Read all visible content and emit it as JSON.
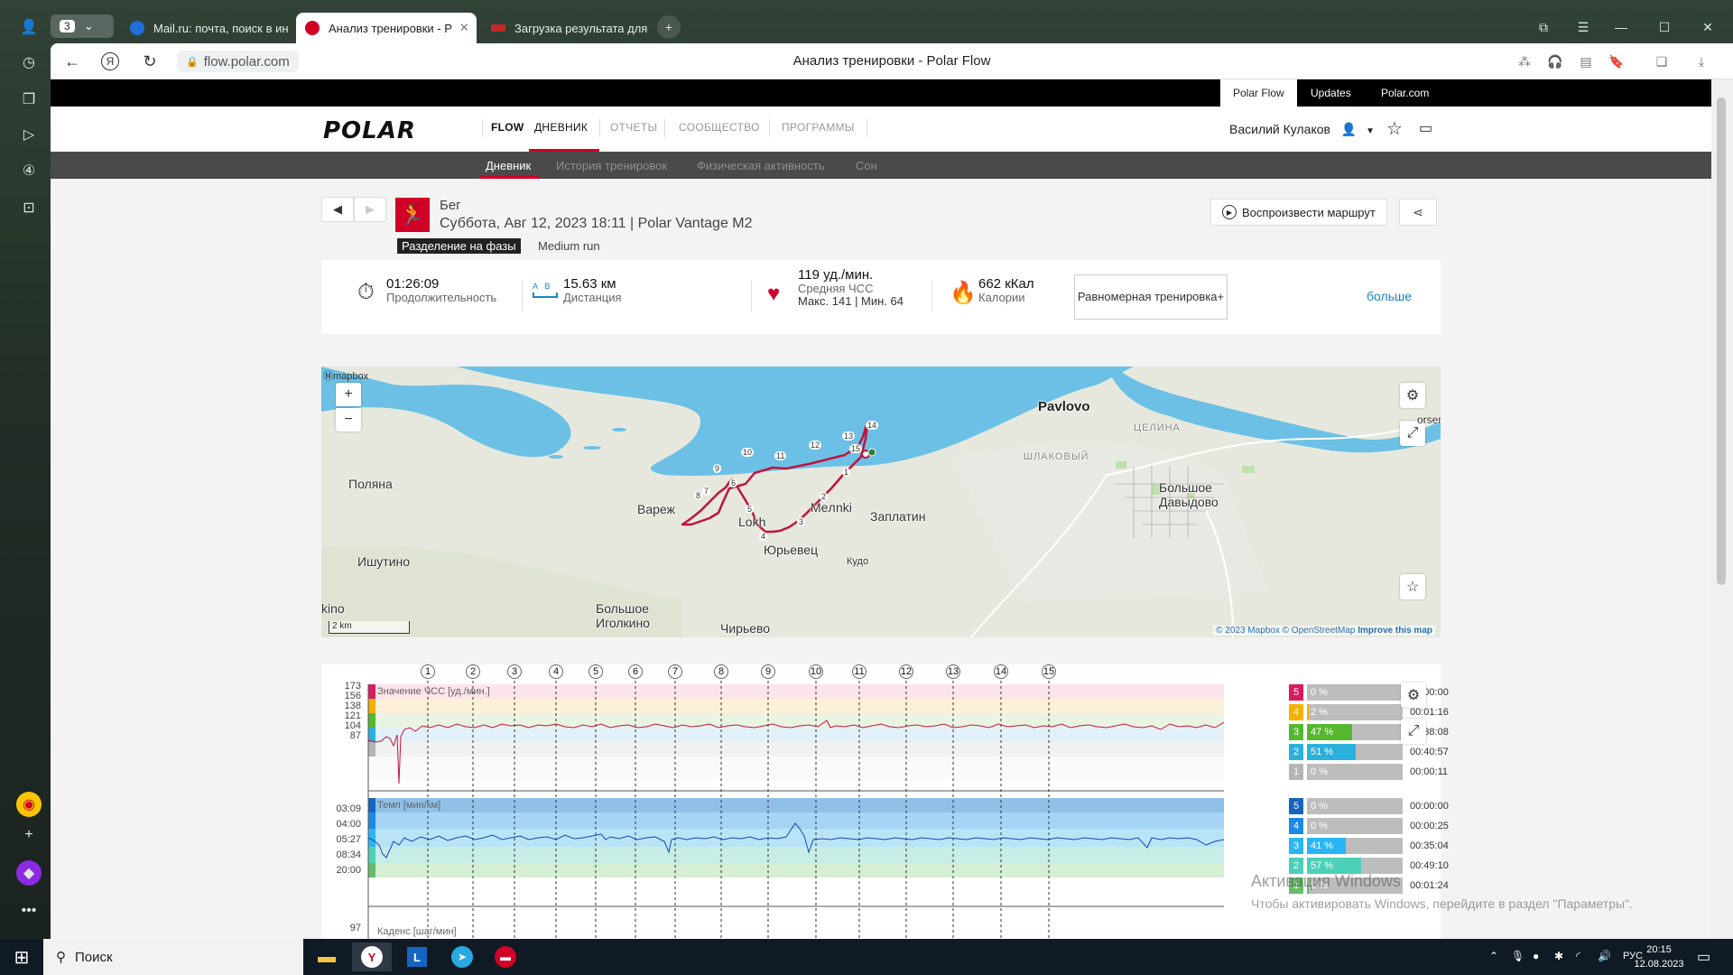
{
  "browser": {
    "tab_count": "3",
    "tabs": [
      {
        "title": "Mail.ru: почта, поиск в ин"
      },
      {
        "title": "Анализ тренировки - P"
      },
      {
        "title": "Загрузка результата для"
      }
    ],
    "url": "flow.polar.com",
    "page_title": "Анализ тренировки - Polar Flow"
  },
  "top_links": [
    "Polar Flow",
    "Updates",
    "Polar.com"
  ],
  "main_nav": {
    "logo": "POLAR",
    "flow": "FLOW",
    "items": [
      "ДНЕВНИК",
      "ОТЧЕТЫ",
      "СООБЩЕСТВО",
      "ПРОГРАММЫ"
    ],
    "user": "Василий Кулаков"
  },
  "sub_nav": [
    "Дневник",
    "История тренировок",
    "Физическая активность",
    "Сон"
  ],
  "training": {
    "sport": "Бег",
    "subtitle": "Суббота, Авг 12, 2023 18:11 | Polar Vantage M2",
    "phase_badge": "Разделение на фазы",
    "phase_name": "Medium run",
    "replay_label": "Воспроизвести маршрут"
  },
  "summary": {
    "duration_value": "01:26:09",
    "duration_label": "Продолжительность",
    "distance_a": "A",
    "distance_b": "B",
    "distance_value": "15.63 км",
    "distance_label": "Дистанция",
    "hr_value": "119 уд./мин.",
    "hr_label": "Средняя ЧСС",
    "hr_extra": "Макс. 141  |  Мин. 64",
    "cal_value": "662 кКал",
    "cal_label": "Калории",
    "phase_btn": "Равномерная тренировка+",
    "more": "больше"
  },
  "map": {
    "logo": "mapbox",
    "zoom_in": "+",
    "zoom_out": "−",
    "labels": [
      "Pavlovo",
      "Поляна",
      "Вареж",
      "Lokh",
      "Meл",
      "nki",
      "Заплатин",
      "Юрьевец",
      "Ишутино",
      "Большое Давыдово",
      "kino",
      "Большое Иголкино",
      "Чирьево",
      "Кудо",
      "ЦЕЛИНА",
      "ШЛАКОВЫЙ",
      "orser"
    ],
    "route_marks": [
      "1",
      "2",
      "3",
      "4",
      "5",
      "6",
      "7",
      "8",
      "9",
      "10",
      "11",
      "12",
      "13",
      "14",
      "15"
    ],
    "scale": "2 km",
    "attribution_1": "© 2023 Mapbox",
    "attribution_2": "© OpenStreetMap",
    "attribution_3": "Improve this map"
  },
  "charts": {
    "laps": [
      "1",
      "2",
      "3",
      "4",
      "5",
      "6",
      "7",
      "8",
      "9",
      "10",
      "11",
      "12",
      "13",
      "14",
      "15"
    ],
    "hr": {
      "label": "Значение ЧСС [уд./мин.]",
      "ticks": [
        "173",
        "156",
        "138",
        "121",
        "104",
        "87"
      ],
      "zones": [
        {
          "n": "5",
          "pct": "0 %",
          "fill": 0.0,
          "time": "00:00:00",
          "color": "#d81b60"
        },
        {
          "n": "4",
          "pct": "2 %",
          "fill": 0.02,
          "time": "00:01:16",
          "color": "#f5b100"
        },
        {
          "n": "3",
          "pct": "47 %",
          "fill": 0.47,
          "time": "00:38:08",
          "color": "#55b82e"
        },
        {
          "n": "2",
          "pct": "51 %",
          "fill": 0.51,
          "time": "00:40:57",
          "color": "#2bb0dd"
        },
        {
          "n": "1",
          "pct": "0 %",
          "fill": 0.0,
          "time": "00:00:11",
          "color": "#b5b5b5"
        }
      ]
    },
    "pace": {
      "label": "Темп [мин/км]",
      "ticks": [
        "03:09",
        "04:00",
        "05:27",
        "08:34",
        "20:00"
      ],
      "zones": [
        {
          "n": "5",
          "pct": "0 %",
          "fill": 0.0,
          "time": "00:00:00",
          "color": "#1565c0"
        },
        {
          "n": "4",
          "pct": "0 %",
          "fill": 0.0,
          "time": "00:00:25",
          "color": "#1e88e5"
        },
        {
          "n": "3",
          "pct": "41 %",
          "fill": 0.41,
          "time": "00:35:04",
          "color": "#29b6f6"
        },
        {
          "n": "2",
          "pct": "57 %",
          "fill": 0.57,
          "time": "00:49:10",
          "color": "#4dd0b8"
        },
        {
          "n": "1",
          "pct": "2 %",
          "fill": 0.02,
          "time": "00:01:24",
          "color": "#66bb6a"
        }
      ]
    },
    "cadence": {
      "label": "Каденс [шаг/мин]",
      "tick": "97"
    }
  },
  "watermark": {
    "line1": "Активация Windows",
    "line2": "Чтобы активировать Windows, перейдите в раздел \"Параметры\"."
  },
  "taskbar": {
    "search": "Поиск",
    "lang": "РУС",
    "time": "20:15",
    "date": "12.08.2023"
  }
}
